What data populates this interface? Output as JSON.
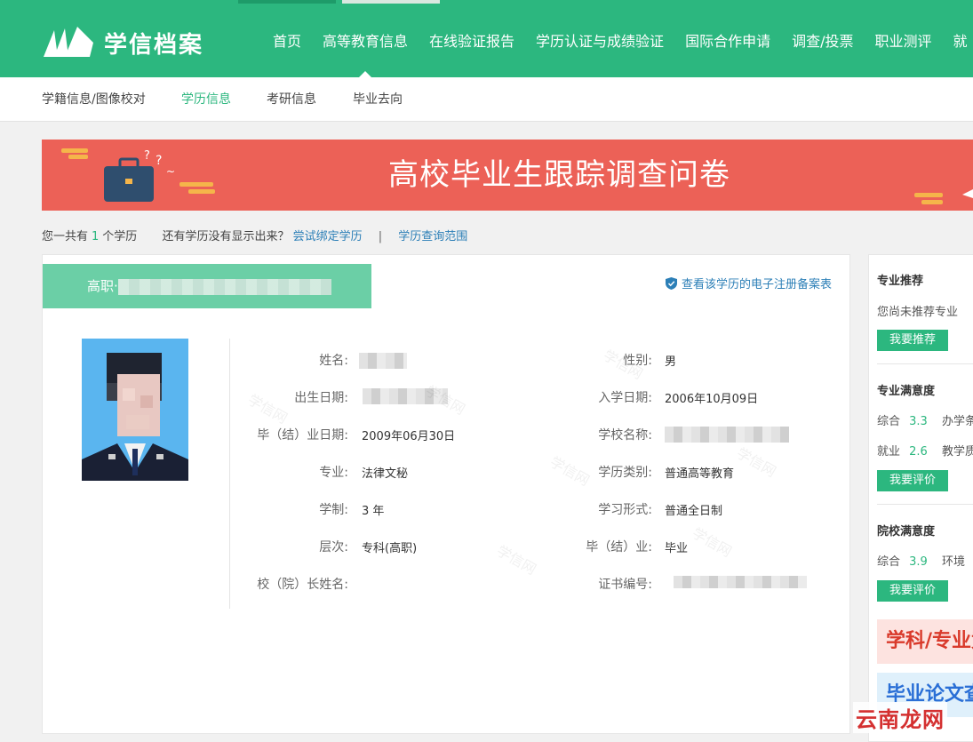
{
  "header": {
    "logo_text": "学信档案",
    "nav": [
      "首页",
      "高等教育信息",
      "在线验证报告",
      "学历认证与成绩验证",
      "国际合作申请",
      "调查/投票",
      "职业测评",
      "就"
    ]
  },
  "subnav": [
    "学籍信息/图像校对",
    "学历信息",
    "考研信息",
    "毕业去向"
  ],
  "banner": {
    "title": "高校毕业生跟踪调查问卷"
  },
  "summary": {
    "prefix": "您一共有",
    "count": "1",
    "suffix": "个学历",
    "question": "还有学历没有显示出来？",
    "bind_link": "尝试绑定学历",
    "separator": "|",
    "scope_link": "学历查询范围"
  },
  "record": {
    "heading": "高职·",
    "register_link": "查看该学历的电子注册备案表",
    "fields": {
      "name_label": "姓名:",
      "gender_label": "性别:",
      "gender": "男",
      "birth_label": "出生日期:",
      "enroll_label": "入学日期:",
      "enroll": "2006年10月09日",
      "grad_label": "毕（结）业日期:",
      "grad": "2009年06月30日",
      "school_label": "学校名称:",
      "major_label": "专业:",
      "major": "法律文秘",
      "category_label": "学历类别:",
      "category": "普通高等教育",
      "duration_label": "学制:",
      "duration": "3 年",
      "form_label": "学习形式:",
      "form": "普通全日制",
      "level_label": "层次:",
      "level": "专科(高职)",
      "status_label": "毕（结）业:",
      "status": "毕业",
      "president_label": "校（院）长姓名:",
      "cert_label": "证书编号:"
    },
    "watermark": "学信网"
  },
  "sidebar": {
    "rec_title": "专业推荐",
    "rec_text": "您尚未推荐专业",
    "rec_btn": "我要推荐",
    "major_sat_title": "专业满意度",
    "major_sat_r1_a": "综合",
    "major_sat_r1_a_score": "3.3",
    "major_sat_r1_b": "办学条",
    "major_sat_r2_a": "就业",
    "major_sat_r2_a_score": "2.6",
    "major_sat_r2_b": "教学质",
    "major_sat_btn": "我要评价",
    "school_sat_title": "院校满意度",
    "school_sat_r1_a": "综合",
    "school_sat_r1_a_score": "3.9",
    "school_sat_r1_b": "环境",
    "school_sat_btn": "我要评价",
    "ad1": "学科/专业竞",
    "ad2": "毕业论文查"
  },
  "corner_mark": "云南龙网",
  "colors": {
    "primary": "#2cb77f",
    "banner": "#ec6157",
    "link": "#2c7fb7"
  }
}
